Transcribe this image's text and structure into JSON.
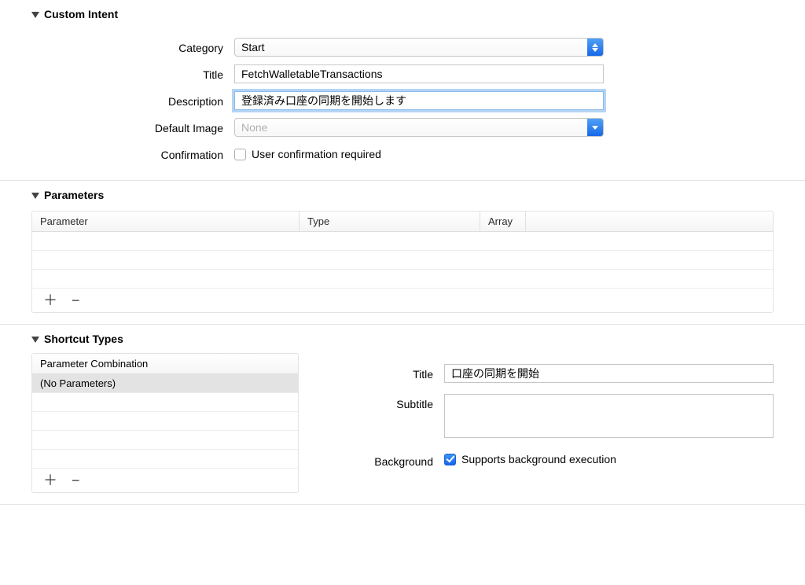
{
  "sections": {
    "customIntent": {
      "title": "Custom Intent",
      "fields": {
        "category": {
          "label": "Category",
          "value": "Start"
        },
        "title": {
          "label": "Title",
          "value": "FetchWalletableTransactions"
        },
        "description": {
          "label": "Description",
          "value": "登録済み口座の同期を開始します"
        },
        "defaultImage": {
          "label": "Default Image",
          "value": "None"
        },
        "confirmation": {
          "label": "Confirmation",
          "checkboxLabel": "User confirmation required",
          "checked": false
        }
      }
    },
    "parameters": {
      "title": "Parameters",
      "columns": {
        "parameter": "Parameter",
        "type": "Type",
        "array": "Array"
      },
      "rows": []
    },
    "shortcutTypes": {
      "title": "Shortcut Types",
      "listHeader": "Parameter Combination",
      "listRows": [
        {
          "label": "(No Parameters)",
          "selected": true
        }
      ],
      "detail": {
        "title": {
          "label": "Title",
          "value": "口座の同期を開始"
        },
        "subtitle": {
          "label": "Subtitle",
          "value": ""
        },
        "background": {
          "label": "Background",
          "checkboxLabel": "Supports background execution",
          "checked": true
        }
      }
    }
  },
  "glyphs": {
    "plus": "＋",
    "minus": "−"
  }
}
